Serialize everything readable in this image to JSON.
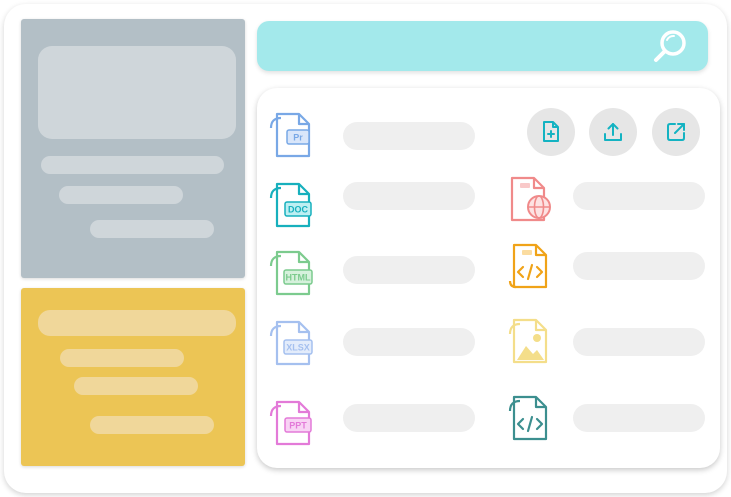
{
  "search": {
    "icon": "search-icon"
  },
  "colors": {
    "gray_card": "#b3bfc6",
    "yellow_card": "#ecc555",
    "search_bar": "#a3e9eb",
    "accent_teal": "#14b3c2"
  },
  "actions": [
    {
      "icon": "new-file-icon"
    },
    {
      "icon": "upload-icon"
    },
    {
      "icon": "external-link-icon"
    }
  ],
  "files": {
    "pr": {
      "label": "Pr",
      "color": "#79a8e6"
    },
    "doc": {
      "label": "DOC",
      "color": "#17b0bd"
    },
    "html": {
      "label": "HTML",
      "color": "#7ccb8e"
    },
    "xlsx": {
      "label": "XLSX",
      "color": "#a5c0ef"
    },
    "ppt": {
      "label": "PPT",
      "color": "#e37ad8"
    },
    "web": {
      "icon": "web-file-icon",
      "color": "#f08a8a"
    },
    "code_orange": {
      "icon": "code-file-icon",
      "color": "#f0a318"
    },
    "image": {
      "icon": "image-file-icon",
      "color": "#f4de8a"
    },
    "code_teal": {
      "icon": "code-file-icon",
      "color": "#3c8f8f"
    }
  }
}
